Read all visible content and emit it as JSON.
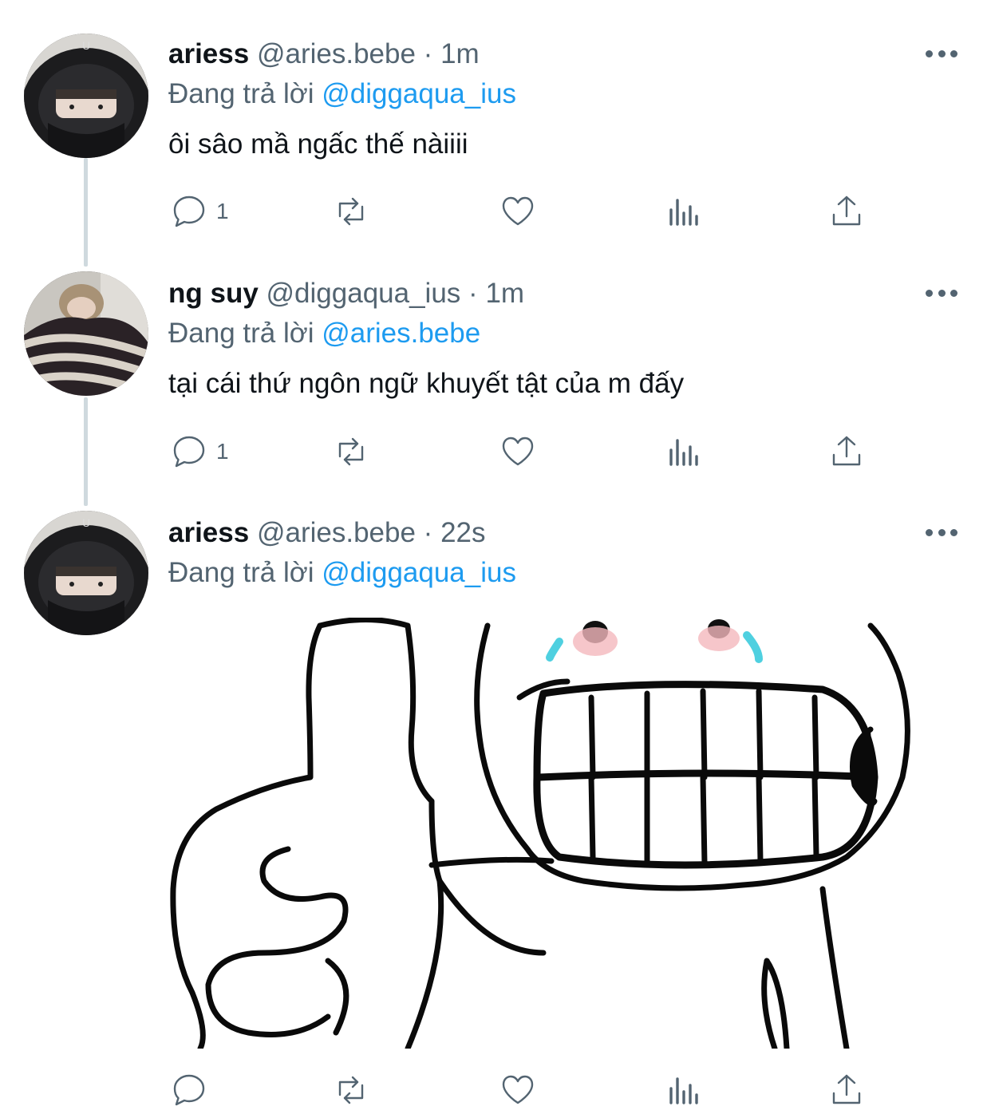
{
  "tweets": [
    {
      "name": "ariess",
      "handle": "@aries.bebe",
      "time": "1m",
      "replying_prefix": "Đang trả lời",
      "replying_to": "@diggaqua_ius",
      "text": "ôi sâo mầ ngấc thế nàiiii",
      "reply_count": "1",
      "avatar_icon": "helmet-avatar"
    },
    {
      "name": "ng suy",
      "handle": "@diggaqua_ius",
      "time": "1m",
      "replying_prefix": "Đang trả lời",
      "replying_to": "@aries.bebe",
      "text": "tại cái thứ ngôn ngữ khuyết tật của m đấy",
      "reply_count": "1",
      "avatar_icon": "striped-sweater-avatar"
    },
    {
      "name": "ariess",
      "handle": "@aries.bebe",
      "time": "22s",
      "replying_prefix": "Đang trả lời",
      "replying_to": "@diggaqua_ius",
      "reply_count": "",
      "avatar_icon": "helmet-avatar",
      "media": "thumbs-up-crying-meme"
    }
  ],
  "separator": "·",
  "colors": {
    "link": "#1d9bf0",
    "muted": "#536471",
    "text": "#0f1419",
    "thread": "#cfd9de"
  }
}
